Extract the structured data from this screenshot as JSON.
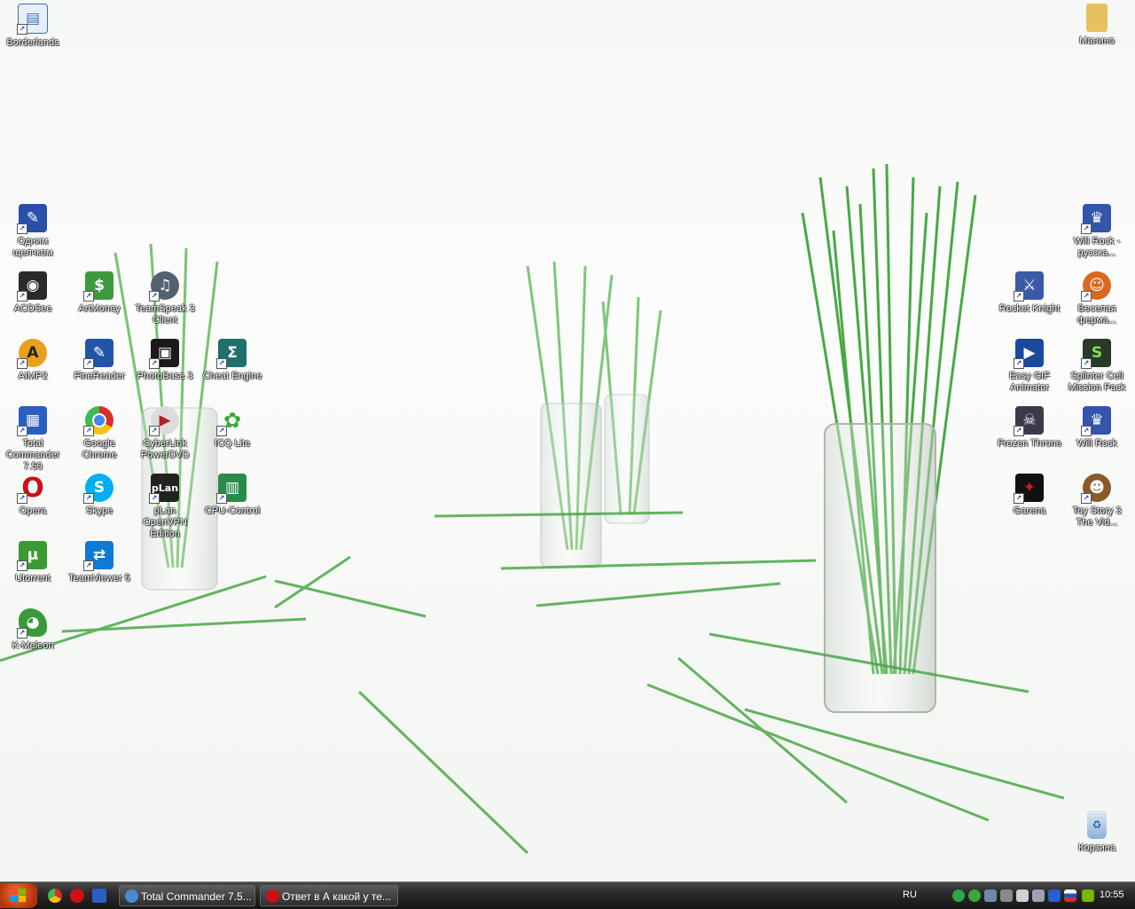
{
  "desktop": {
    "icons": [
      {
        "label": "Borderlands",
        "icon": "borderlands-icon",
        "color": "#3a6fc0"
      },
      {
        "label": "Одним щелчком",
        "icon": "one-click-icon",
        "color": "#2a4fa8"
      },
      {
        "label": "ACDSee",
        "icon": "acdsee-icon",
        "color": "#2a2a2a"
      },
      {
        "label": "ArtMoney",
        "icon": "artmoney-icon",
        "color": "#3c9a3c"
      },
      {
        "label": "TeamSpeak 3 Client",
        "icon": "teamspeak-icon",
        "color": "#556070"
      },
      {
        "label": "AIMP2",
        "icon": "aimp-icon",
        "color": "#e8a020"
      },
      {
        "label": "FineReader",
        "icon": "finereader-icon",
        "color": "#2255aa"
      },
      {
        "label": "PhotoBase 3",
        "icon": "photobase-icon",
        "color": "#1a1a1a"
      },
      {
        "label": "Cheat Engine",
        "icon": "cheat-engine-icon",
        "color": "#1f6f6f"
      },
      {
        "label": "Total Commander 7.50",
        "icon": "total-commander-icon",
        "color": "#2b5fbf"
      },
      {
        "label": "Google Chrome",
        "icon": "chrome-icon",
        "color": "#d93025"
      },
      {
        "label": "CyberLink PowerDVD",
        "icon": "powerdvd-icon",
        "color": "#b22222"
      },
      {
        "label": "ICQ Lite",
        "icon": "icq-icon",
        "color": "#3aa83a"
      },
      {
        "label": "Opera",
        "icon": "opera-icon",
        "color": "#cc0f16"
      },
      {
        "label": "Skype",
        "icon": "skype-icon",
        "color": "#00aff0"
      },
      {
        "label": "pLan OpenVPN Edition",
        "icon": "plan-openvpn-icon",
        "color": "#222222"
      },
      {
        "label": "CPU-Control",
        "icon": "cpu-control-icon",
        "color": "#2a8a4a"
      },
      {
        "label": "Utorrent",
        "icon": "utorrent-icon",
        "color": "#3c9a32"
      },
      {
        "label": "TeamViewer 5",
        "icon": "teamviewer-icon",
        "color": "#0e7ad4"
      },
      {
        "label": "K-Meleon",
        "icon": "k-meleon-icon",
        "color": "#3a9a3a"
      },
      {
        "label": "Манино",
        "icon": "folder-icon",
        "color": "#e8c060"
      },
      {
        "label": "Will Rock - русска...",
        "icon": "will-rock-ru-icon",
        "color": "#3355aa"
      },
      {
        "label": "Rocket Knight",
        "icon": "rocket-knight-icon",
        "color": "#3a5aa8"
      },
      {
        "label": "Веселая ферма...",
        "icon": "funny-farm-icon",
        "color": "#d86a20"
      },
      {
        "label": "Easy GIF Animator",
        "icon": "easy-gif-icon",
        "color": "#1a4aa0"
      },
      {
        "label": "Splinter Cell Mission Pack",
        "icon": "splinter-cell-icon",
        "color": "#2a3a2a"
      },
      {
        "label": "Frozen Throne",
        "icon": "frozen-throne-icon",
        "color": "#3a3a4a"
      },
      {
        "label": "Will Rock",
        "icon": "will-rock-icon",
        "color": "#3355aa"
      },
      {
        "label": "Garena",
        "icon": "garena-icon",
        "color": "#b01a1a"
      },
      {
        "label": "Toy Story 3 The Vid...",
        "icon": "toy-story-icon",
        "color": "#8a5a2a"
      },
      {
        "label": "Корзина",
        "icon": "recycle-bin-icon",
        "color": "#8ab0d8"
      }
    ]
  },
  "taskbar": {
    "start_icon": "windows-logo-icon",
    "quick_launch": [
      {
        "icon": "chrome-icon",
        "color": "#d93025"
      },
      {
        "icon": "opera-icon",
        "color": "#cc0f16"
      },
      {
        "icon": "show-desktop-icon",
        "color": "#2a5fc0"
      }
    ],
    "tasks": [
      {
        "label": "Total Commander 7.5...",
        "icon": "chrome-icon",
        "color": "#4a8ad4"
      },
      {
        "label": "Ответ в А какой у те...",
        "icon": "opera-icon",
        "color": "#cc0f16"
      }
    ],
    "language": "RU",
    "clock": "10:55",
    "tray_icons": [
      {
        "icon": "network-icon",
        "color": "#2aa84a"
      },
      {
        "icon": "messenger-icon",
        "color": "#3aa83a"
      },
      {
        "icon": "monitor-icon",
        "color": "#6a8ab0"
      },
      {
        "icon": "connection-icon",
        "color": "#8a8a8a"
      },
      {
        "icon": "volume-icon",
        "color": "#d0d0d0"
      },
      {
        "icon": "security-icon",
        "color": "#a0a0b0"
      },
      {
        "icon": "bluetooth-icon",
        "color": "#2a5fd0"
      },
      {
        "icon": "flag-ru-icon",
        "color": "#d03030"
      },
      {
        "icon": "nvidia-icon",
        "color": "#76b900"
      }
    ]
  }
}
